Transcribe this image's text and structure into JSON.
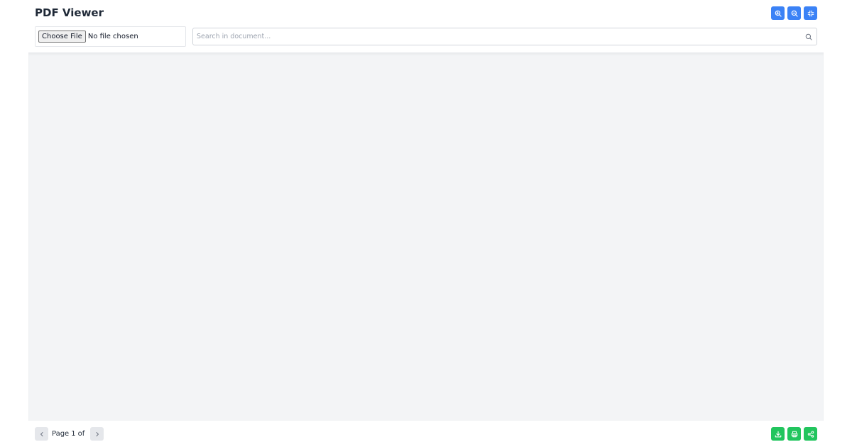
{
  "app": {
    "title": "PDF Viewer"
  },
  "toolbar": {
    "zoom_in_icon": "zoom-in-icon",
    "zoom_out_icon": "zoom-out-icon",
    "fit_icon": "fit-screen-icon"
  },
  "file_input": {
    "button_label": "Choose File",
    "status": "No file chosen"
  },
  "search": {
    "placeholder": "Search in document...",
    "value": ""
  },
  "pagination": {
    "page_label": "Page",
    "current_page": "1",
    "of_label": "of",
    "total_pages": ""
  },
  "actions": {
    "download_icon": "download-icon",
    "print_icon": "print-icon",
    "share_icon": "share-icon"
  },
  "colors": {
    "primary": "#3b82f6",
    "success": "#22c55e",
    "viewer_bg": "#f3f4f6",
    "text": "#1f2937"
  }
}
